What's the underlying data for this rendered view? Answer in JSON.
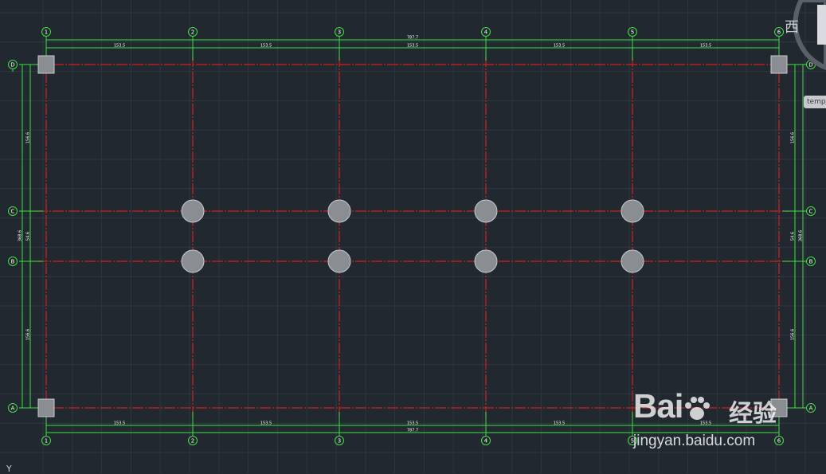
{
  "colors": {
    "background": "#212830",
    "grid": "#2f3742",
    "axis_red": "#d01f1f",
    "dimension_green": "#3fe03f",
    "bubble_green": "#3fe03f",
    "column_fill": "#8a8d91",
    "column_stroke": "#c9cacc",
    "text_white": "#ffffff"
  },
  "drawing": {
    "vertical_axes": [
      "1",
      "2",
      "3",
      "4",
      "5",
      "6"
    ],
    "horizontal_axes": [
      "D",
      "C",
      "B",
      "A"
    ],
    "top_dimension_total": "787.7",
    "top_dimension_spans": [
      "153.5",
      "153.5",
      "153.5",
      "153.5",
      "153.5"
    ],
    "bottom_dimension_total": "787.7",
    "bottom_dimension_spans": [
      "153.5",
      "153.5",
      "153.5",
      "153.5",
      "153.5"
    ],
    "left_dimension_total": "368.6",
    "left_dimension_spans": [
      "156.6",
      "54.6",
      "156.6"
    ],
    "right_dimension_total": "368.6",
    "right_dimension_spans": [
      "156.6",
      "54.6",
      "156.6"
    ],
    "corner_columns": 4,
    "round_columns": 8
  },
  "viewcube": {
    "direction_label": "西"
  },
  "tooltip": {
    "label": "temp"
  },
  "ucs": {
    "label": "Y"
  },
  "watermark": {
    "logo": "Bai",
    "logo_suffix": "du",
    "cn_text": "经验",
    "url": "jingyan.baidu.com"
  }
}
